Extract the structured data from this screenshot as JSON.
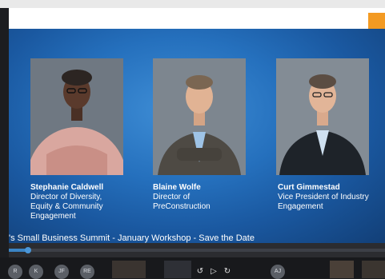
{
  "presenters": [
    {
      "name": "Stephanie Caldwell",
      "title_lines": [
        "Director of Diversity,",
        "Equity & Community",
        "Engagement"
      ]
    },
    {
      "name": "Blaine Wolfe",
      "title_lines": [
        "Director of",
        "PreConstruction"
      ]
    },
    {
      "name": "Curt Gimmestad",
      "title_lines": [
        "Vice President of Industry",
        "Engagement"
      ]
    }
  ],
  "caption": "'s Small Business Summit - January Workshop - Save the Date",
  "playback": {
    "progress_percent": 5
  },
  "participants": [
    "R",
    "K",
    "JF",
    "RE",
    "AJ"
  ],
  "colors": {
    "accent_orange": "#f39a22",
    "slide_blue": "#2570bd",
    "progress_blue": "#3b84c4"
  },
  "icons": [
    "previous-icon",
    "play-icon",
    "next-icon"
  ]
}
